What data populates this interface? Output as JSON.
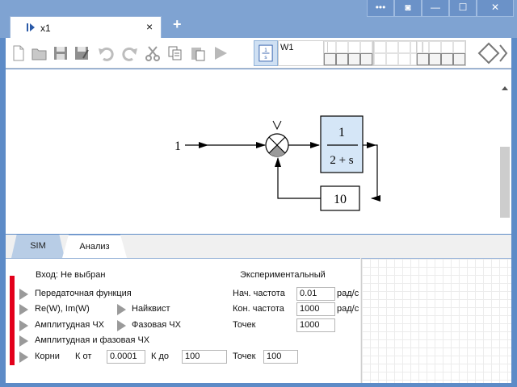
{
  "window": {
    "controls": [
      "•••",
      "◙",
      "—",
      "☐",
      "✕"
    ]
  },
  "doc_tab": {
    "name": "x1",
    "close": "×",
    "new_tab": "+"
  },
  "palette": {
    "label": "W1"
  },
  "diagram": {
    "input_value": "1",
    "block_numerator": "1",
    "block_denominator": "2 + s",
    "feedback_gain": "10"
  },
  "panel": {
    "tabs": [
      "SIM",
      "Анализ"
    ],
    "input_label": "Вход: Не выбран",
    "experimental_label": "Экспериментальный",
    "items": {
      "transfer": "Передаточная функция",
      "re_im": "Re(W), Im(W)",
      "nyquist": "Найквист",
      "amplitude": "Амплитудная ЧХ",
      "phase": "Фазовая ЧХ",
      "amp_phase": "Амплитудная и фазовая ЧХ",
      "roots": "Корни"
    },
    "roots": {
      "k_from_label": "К от",
      "k_from": "0.0001",
      "k_to_label": "К до",
      "k_to": "100",
      "points_label": "Точек",
      "points": "100"
    },
    "freq": {
      "start_label": "Нач. частота",
      "start": "0.01",
      "start_unit": "рад/с",
      "end_label": "Кон. частота",
      "end": "1000",
      "end_unit": "рад/с",
      "points_label": "Точек",
      "points": "1000"
    }
  }
}
